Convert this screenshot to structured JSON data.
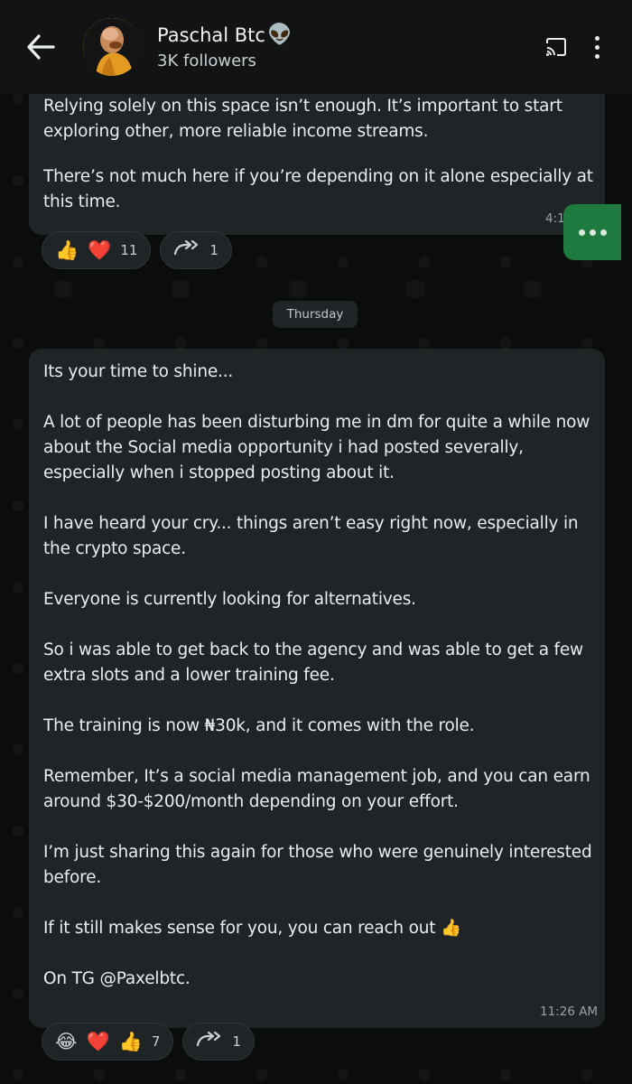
{
  "header": {
    "channel_name": "Paschal Btc",
    "channel_emoji": "👽",
    "followers": "3K followers"
  },
  "message1": {
    "para1": "Relying solely on this space isn’t enough. It’s important to start exploring other, more reliable income streams.",
    "para2": "There’s not much here if you’re depending on it alone especially at this time.",
    "time": "4:12 PM",
    "reactions": {
      "emoji1": "👍",
      "emoji2": "❤️",
      "count": "11",
      "forward_count": "1"
    }
  },
  "date_separator": "Thursday",
  "message2": {
    "paragraphs": [
      "Its your time to shine...",
      "A lot of people has been disturbing me in dm for quite a while now about the Social media opportunity i had posted severally, especially when i stopped posting about it.",
      "I have heard your cry... things aren’t easy right now, especially in the crypto space.",
      "Everyone is currently looking for alternatives.",
      "So i was able to get back to the agency and was able to get a few extra slots and a lower training fee.",
      "The training is now ₦30k, and it comes with the role.",
      "Remember, It’s a social media management job, and you can earn around $30-$200/month depending on your effort.",
      "I’m just sharing this again for those who were genuinely interested before.",
      "If it still makes sense for you, you can reach out 👍",
      "On TG @Paxelbtc."
    ],
    "time": "11:26 AM",
    "reactions": {
      "emoji1": "😂",
      "emoji2": "❤️",
      "emoji3": "👍",
      "count": "7",
      "forward_count": "1"
    }
  },
  "icons": {
    "back": "arrow-left-icon",
    "cast": "cast-icon",
    "more": "more-vertical-icon",
    "forward": "forward-icon"
  },
  "colors": {
    "background": "#0b0d0c",
    "bubble": "#1f2426",
    "header": "#111413",
    "accent_green": "#1f7a3f"
  }
}
